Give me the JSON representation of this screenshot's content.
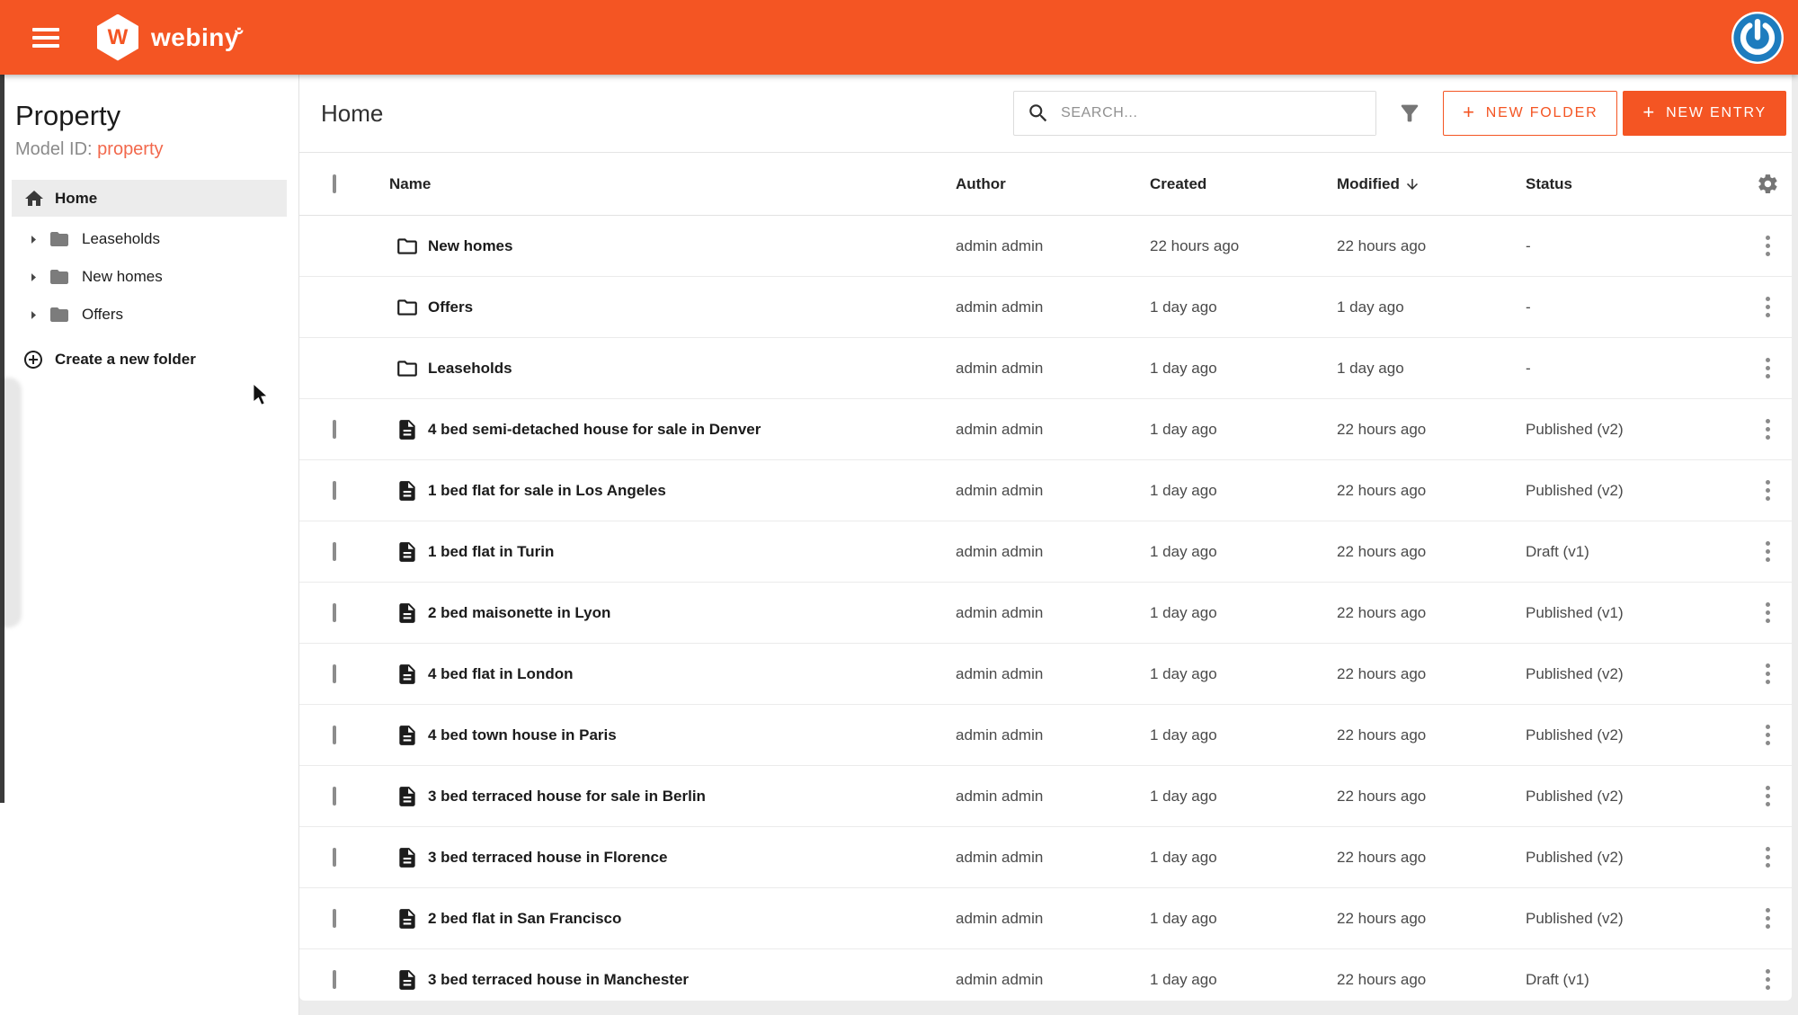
{
  "colors": {
    "accent": "#F45523",
    "avatar_blue": "#1E7CBE",
    "model_id_accent": "#F2684C"
  },
  "appbar": {
    "logo_text": "webiny"
  },
  "sidebar": {
    "title": "Property",
    "model_id_label": "Model ID:",
    "model_id_value": "property",
    "home_label": "Home",
    "folders": [
      {
        "label": "Leaseholds"
      },
      {
        "label": "New homes"
      },
      {
        "label": "Offers"
      }
    ],
    "create_folder_label": "Create a new folder"
  },
  "toolbar": {
    "title": "Home",
    "search_placeholder": "SEARCH...",
    "new_folder_label": "NEW FOLDER",
    "new_entry_label": "NEW ENTRY"
  },
  "table": {
    "columns": [
      "Name",
      "Author",
      "Created",
      "Modified",
      "Status"
    ],
    "sort_column": "Modified",
    "sort_direction": "desc",
    "rows": [
      {
        "type": "folder",
        "name": "New homes",
        "author": "admin admin",
        "created": "22 hours ago",
        "modified": "22 hours ago",
        "status": "-"
      },
      {
        "type": "folder",
        "name": "Offers",
        "author": "admin admin",
        "created": "1 day ago",
        "modified": "1 day ago",
        "status": "-"
      },
      {
        "type": "folder",
        "name": "Leaseholds",
        "author": "admin admin",
        "created": "1 day ago",
        "modified": "1 day ago",
        "status": "-"
      },
      {
        "type": "entry",
        "name": "4 bed semi-detached house for sale in Denver",
        "author": "admin admin",
        "created": "1 day ago",
        "modified": "22 hours ago",
        "status": "Published (v2)"
      },
      {
        "type": "entry",
        "name": "1 bed flat for sale in Los Angeles",
        "author": "admin admin",
        "created": "1 day ago",
        "modified": "22 hours ago",
        "status": "Published (v2)"
      },
      {
        "type": "entry",
        "name": "1 bed flat in Turin",
        "author": "admin admin",
        "created": "1 day ago",
        "modified": "22 hours ago",
        "status": "Draft (v1)"
      },
      {
        "type": "entry",
        "name": "2 bed maisonette in Lyon",
        "author": "admin admin",
        "created": "1 day ago",
        "modified": "22 hours ago",
        "status": "Published (v1)"
      },
      {
        "type": "entry",
        "name": "4 bed flat in London",
        "author": "admin admin",
        "created": "1 day ago",
        "modified": "22 hours ago",
        "status": "Published (v2)"
      },
      {
        "type": "entry",
        "name": "4 bed town house in Paris",
        "author": "admin admin",
        "created": "1 day ago",
        "modified": "22 hours ago",
        "status": "Published (v2)"
      },
      {
        "type": "entry",
        "name": "3 bed terraced house for sale in Berlin",
        "author": "admin admin",
        "created": "1 day ago",
        "modified": "22 hours ago",
        "status": "Published (v2)"
      },
      {
        "type": "entry",
        "name": "3 bed terraced house in Florence",
        "author": "admin admin",
        "created": "1 day ago",
        "modified": "22 hours ago",
        "status": "Published (v2)"
      },
      {
        "type": "entry",
        "name": "2 bed flat in San Francisco",
        "author": "admin admin",
        "created": "1 day ago",
        "modified": "22 hours ago",
        "status": "Published (v2)"
      },
      {
        "type": "entry",
        "name": "3 bed terraced house in Manchester",
        "author": "admin admin",
        "created": "1 day ago",
        "modified": "22 hours ago",
        "status": "Draft (v1)"
      }
    ]
  }
}
